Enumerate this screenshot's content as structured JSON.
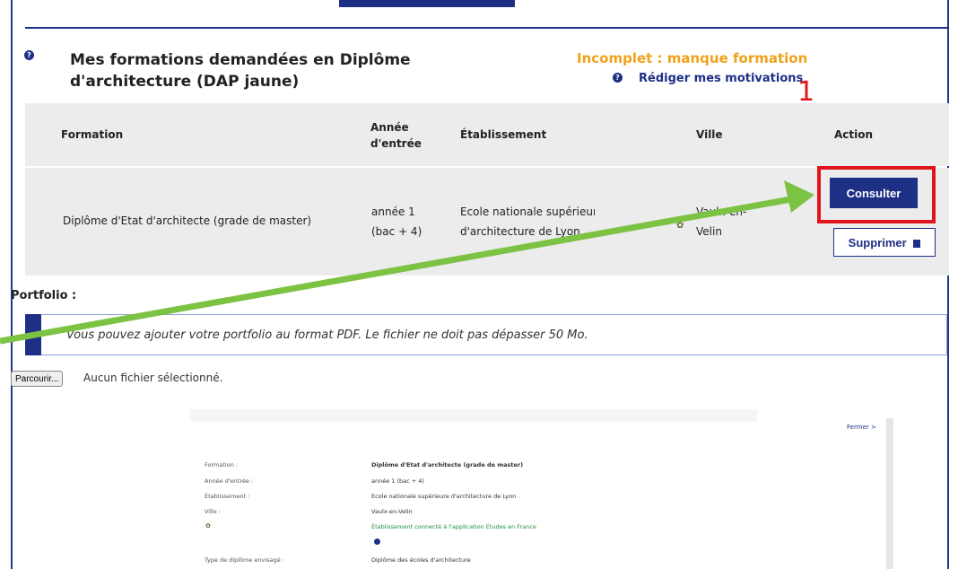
{
  "header": {
    "title": "Mes formations demandées en Diplôme d'architecture (DAP jaune)",
    "status": "Incomplet : manque formation",
    "motivations_link": "Rédiger mes motivations",
    "help_glyph": "?"
  },
  "annotation": {
    "step_number": "1",
    "highlight_color": "#e0151b",
    "arrow_color": "#7cc243"
  },
  "table": {
    "columns": [
      "Formation",
      "Année d'entrée",
      "Établissement",
      "Ville",
      "Action"
    ],
    "rows": [
      {
        "formation": "Diplôme d'Etat d'architecte (grade de master)",
        "annee_line1": "année 1",
        "annee_line2": "(bac + 4)",
        "etab_line1": "Ecole nationale supérieure",
        "etab_line2": "d'architecture de Lyon",
        "ville_line1": "Vaulx-en-",
        "ville_line2": "Velin",
        "consult_label": "Consulter",
        "delete_label": "Supprimer"
      }
    ]
  },
  "portfolio": {
    "label": "Portfolio :",
    "info_text": "Vous pouvez ajouter votre portfolio au format PDF. Le fichier ne doit pas dépasser 50 Mo.",
    "browse_label": "Parcourir...",
    "file_status": "Aucun fichier sélectionné."
  },
  "preview": {
    "close_label": "Fermer",
    "labels": [
      "Formation :",
      "Année d'entrée :",
      "Établissement :",
      "Ville :",
      "Type de diplôme envisagé :"
    ],
    "values": [
      "Diplôme d'Etat d'architecte (grade de master)",
      "année 1 (bac + 4)",
      "Ecole nationale supérieure d'architecture de Lyon",
      "Vaulx-en-Velin",
      "Diplôme des écoles d'architecture"
    ],
    "connected_text": "Établissement connecté à l'application Etudes en France"
  },
  "colors": {
    "primary": "#1e2f86",
    "warning": "#f0a21c",
    "row_bg": "#ececec"
  }
}
